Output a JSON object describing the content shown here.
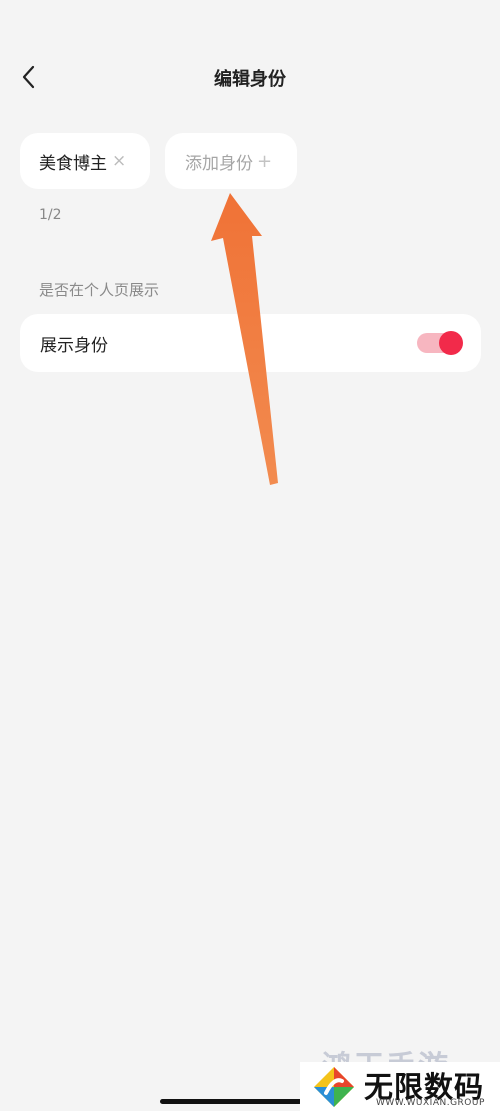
{
  "header": {
    "back_icon": "chevron-left-icon",
    "title": "编辑身份"
  },
  "identity_tags": {
    "selected": [
      {
        "label": "美食博主",
        "remove_symbol": "×"
      }
    ],
    "add_label": "添加身份",
    "add_symbol": "+",
    "count": "1/2"
  },
  "display_section": {
    "heading": "是否在个人页展示",
    "toggle_label": "展示身份",
    "toggle_on": true,
    "accent_color": "#f22a4a"
  },
  "annotation": {
    "arrow_color": "#f07a3b"
  },
  "watermark": {
    "faint_text": "鸿玉手游",
    "title": "无限数码",
    "subtitle": "WWW.WUXIAN.GROUP"
  }
}
